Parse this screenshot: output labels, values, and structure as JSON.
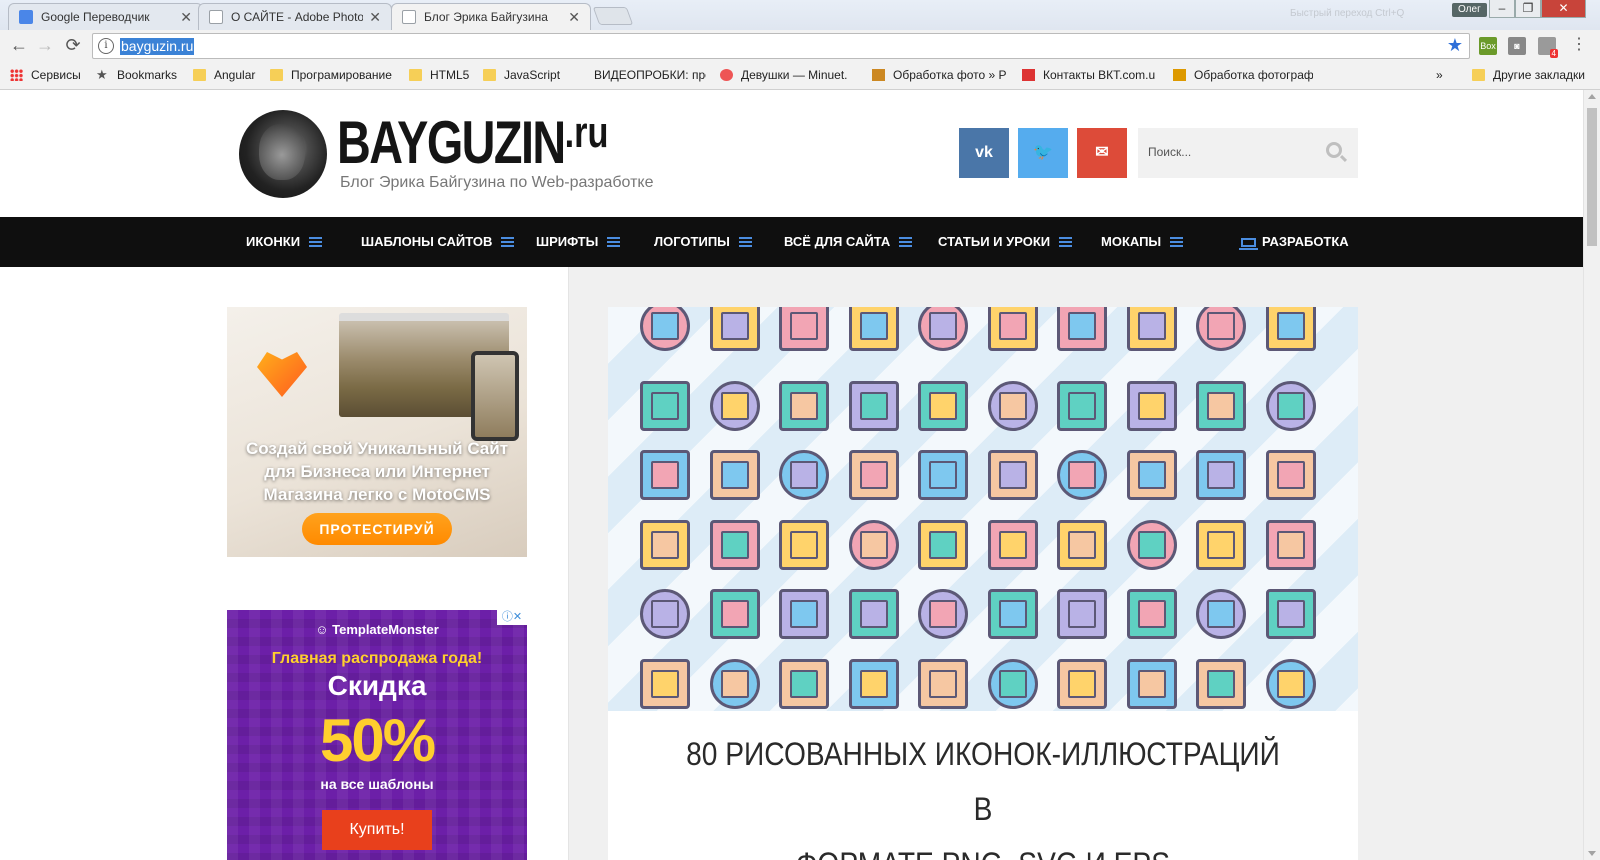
{
  "browser": {
    "tabs": [
      {
        "title": "Google Переводчик",
        "active": false,
        "favicon_color": "#4a86e8"
      },
      {
        "title": "О САЙТЕ - Adobe Photos",
        "active": false,
        "favicon_color": "#9aa0a6"
      },
      {
        "title": "Блог Эрика Байгузина",
        "active": true,
        "favicon_color": "#9aa0a6"
      }
    ],
    "user": "Олег",
    "title_hint": "Быстрый переход Ctrl+Q",
    "url": "bayguzin.ru",
    "extensions_badge": "4"
  },
  "bookmarks": [
    {
      "label": "Сервисы",
      "icon": "apps-icon"
    },
    {
      "label": "Bookmarks",
      "icon": "star-icon"
    },
    {
      "label": "Angular",
      "icon": "folder-icon"
    },
    {
      "label": "Програмирование",
      "icon": "folder-icon"
    },
    {
      "label": "HTML5",
      "icon": "folder-icon"
    },
    {
      "label": "JavaScript",
      "icon": "folder-icon"
    },
    {
      "label": "ВИДЕОПРОБКИ: про",
      "icon": "page-icon"
    },
    {
      "label": "Девушки — Minuet.",
      "icon": "page-icon"
    },
    {
      "label": "Обработка фото » P",
      "icon": "page-icon"
    },
    {
      "label": "Контакты ВКТ.com.u",
      "icon": "page-icon"
    },
    {
      "label": "Обработка фотограф",
      "icon": "page-icon"
    },
    {
      "label": "Другие закладки",
      "icon": "folder-icon"
    }
  ],
  "bookmarks_more": "»",
  "site": {
    "logo_main": "BAYGUZIN",
    "logo_ru": ".ru",
    "tagline": "Блог Эрика Байгузина по Web-разработке",
    "social": [
      {
        "label": "vk",
        "color": "#4a76a8"
      },
      {
        "label": "🐦",
        "color": "#55acee"
      },
      {
        "label": "✉",
        "color": "#dd4b39"
      }
    ],
    "search_placeholder": "Поиск..."
  },
  "menu": [
    {
      "label": "ИКОНКИ"
    },
    {
      "label": "ШАБЛОНЫ САЙТОВ"
    },
    {
      "label": "ШРИФТЫ"
    },
    {
      "label": "ЛОГОТИПЫ"
    },
    {
      "label": "ВСЁ ДЛЯ САЙТА"
    },
    {
      "label": "СТАТЬИ И УРОКИ"
    },
    {
      "label": "МОКАПЫ"
    },
    {
      "label": "РАЗРАБОТКА"
    }
  ],
  "ad_motocms": {
    "text_line1": "Создай свой Уникальный Сайт",
    "text_line2": "для Бизнеса или Интернет",
    "text_line3": "Магазина легко с MotoCMS",
    "button": "ПРОТЕСТИРУЙ"
  },
  "ad_templatemonster": {
    "brand": "TemplateMonster",
    "sale": "Главная распродажа года!",
    "discount_label": "Скидка",
    "discount_value": "50%",
    "note": "на все шаблоны",
    "button": "Купить!"
  },
  "post": {
    "title_line1": "80 РИСОВАННЫХ ИКОНОК-ИЛЛЮСТРАЦИЙ В",
    "title_line2": "ФОРМАТЕ PNG, SVG И EPS"
  },
  "colors": {
    "accent_blue": "#4b8de0",
    "icon_palette": [
      "#f2a5b4",
      "#5fd1c2",
      "#7ec8ef",
      "#ffd36b",
      "#b9b2e6",
      "#f6c7a2"
    ]
  }
}
